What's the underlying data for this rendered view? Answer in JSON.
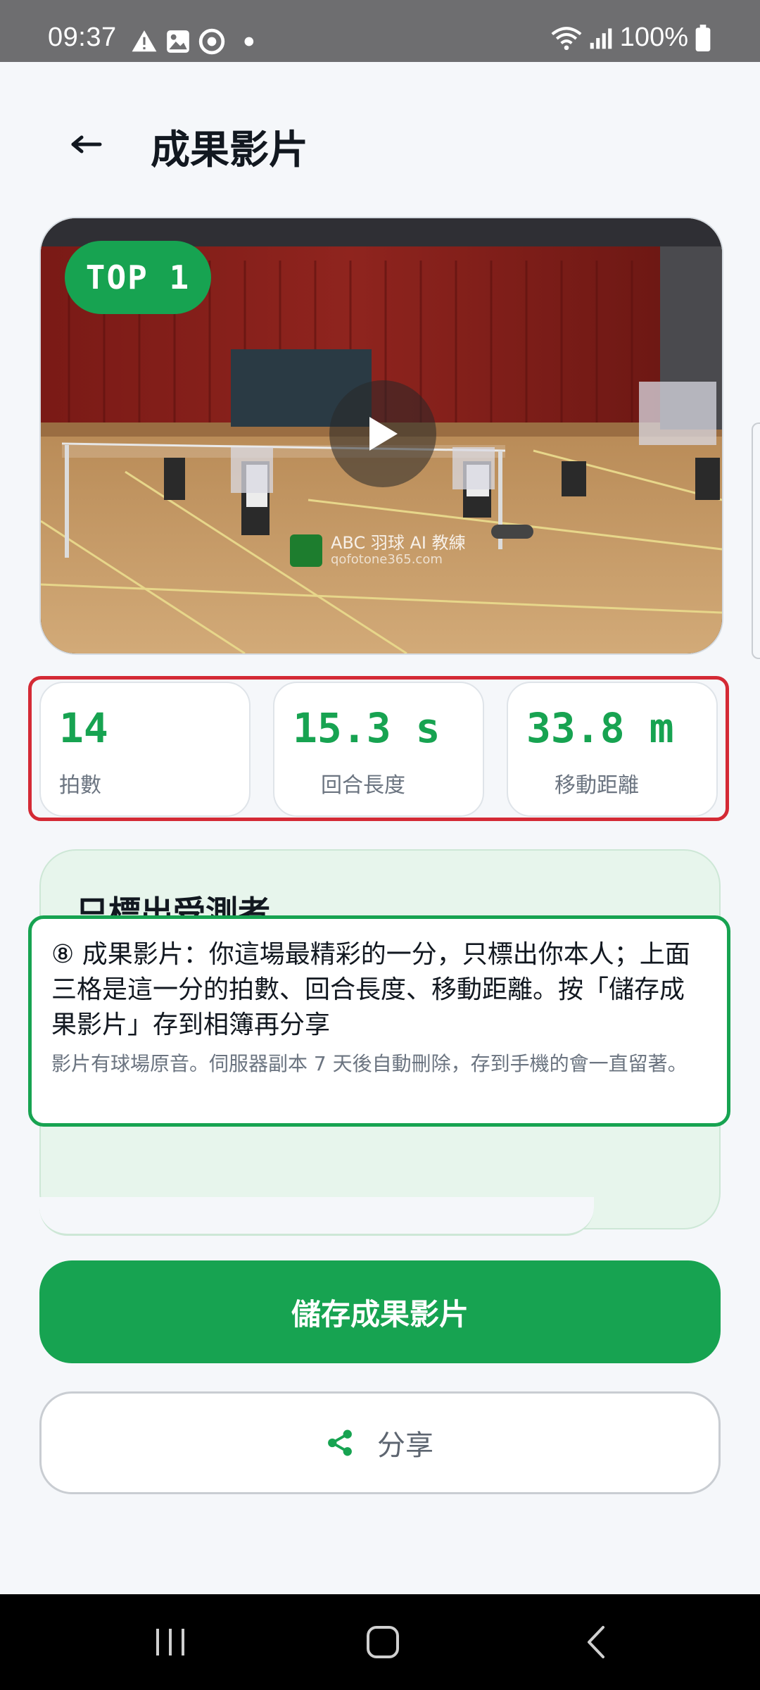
{
  "status_bar": {
    "time": "09:37",
    "battery": "100%",
    "icons": [
      "warning-icon",
      "image-icon",
      "record-icon",
      "dot-icon",
      "wifi-icon",
      "signal-icon",
      "battery-icon"
    ]
  },
  "header": {
    "title": "成果影片"
  },
  "video": {
    "badge": "TOP 1",
    "watermark_title": "ABC 羽球 AI 教練",
    "watermark_sub": "qofotone365.com"
  },
  "stats": [
    {
      "value": "14",
      "label": "拍數"
    },
    {
      "value": "15.3 s",
      "label": "回合長度"
    },
    {
      "value": "33.8 m",
      "label": "移動距離"
    }
  ],
  "info_card": {
    "title": "只標出受測者"
  },
  "tooltip": {
    "main": "⑧ 成果影片：你這場最精彩的一分，只標出你本人；上面三格是這一分的拍數、回合長度、移動距離。按「儲存成果影片」存到相簿再分享",
    "sub": "影片有球場原音。伺服器副本 7 天後自動刪除，存到手機的會一直留著。"
  },
  "actions": {
    "save_label": "儲存成果影片",
    "share_label": "分享"
  },
  "colors": {
    "accent": "#17a351",
    "highlight_red": "#d42a35",
    "text": "#121820",
    "muted": "#6b7480"
  }
}
